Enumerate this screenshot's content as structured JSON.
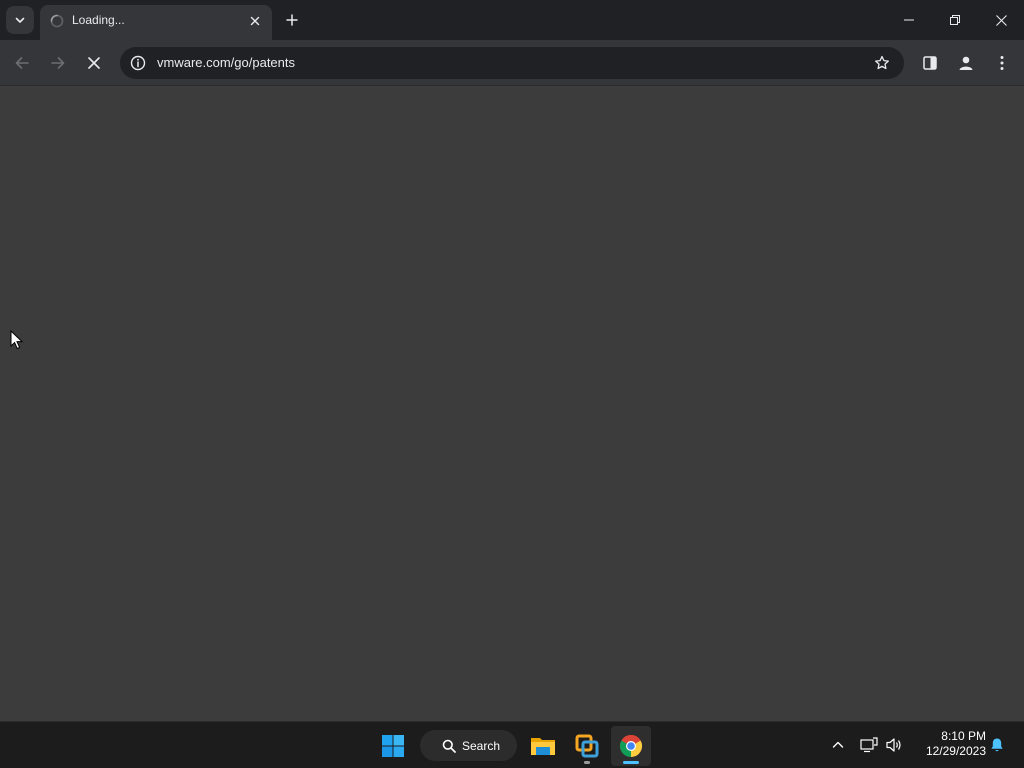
{
  "browser": {
    "tab": {
      "title": "Loading..."
    },
    "address": {
      "url": "vmware.com/go/patents"
    }
  },
  "taskbar": {
    "search_label": "Search",
    "clock": {
      "time": "8:10 PM",
      "date": "12/29/2023"
    },
    "pinned": [
      "windows-start-icon",
      "file-explorer-icon",
      "vmware-workstation-icon",
      "chrome-icon"
    ]
  },
  "colors": {
    "tabstrip": "#202124",
    "toolbar": "#35363a",
    "content": "#3c3c3c",
    "taskbar": "#1c1c1c",
    "accent": "#4cc2ff"
  }
}
